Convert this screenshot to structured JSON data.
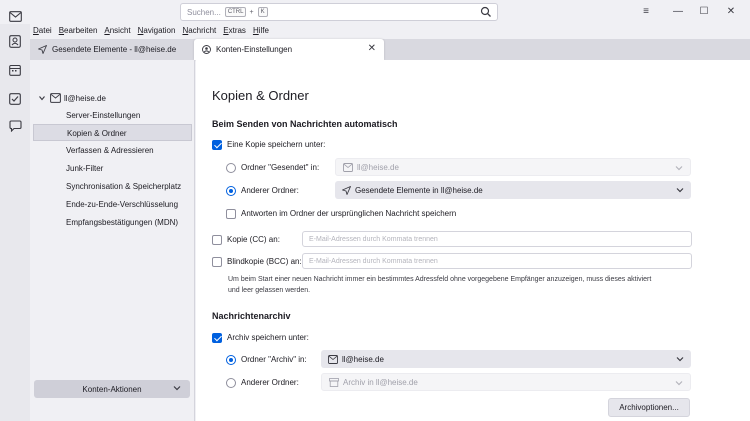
{
  "search": {
    "placeholder": "Suchen...",
    "shortcut_key1": "CTRL",
    "shortcut_plus": "+",
    "shortcut_key2": "K"
  },
  "window": {
    "menu": "≡",
    "minimize": "—",
    "maximize": "☐",
    "close": "✕"
  },
  "menubar": [
    "Datei",
    "Bearbeiten",
    "Ansicht",
    "Navigation",
    "Nachricht",
    "Extras",
    "Hilfe"
  ],
  "tabs": [
    {
      "label": "Gesendete Elemente - ll@heise.de",
      "icon": "send-icon"
    },
    {
      "label": "Konten-Einstellungen",
      "icon": "account-settings-icon",
      "close": "✕"
    }
  ],
  "tree": {
    "account": "ll@heise.de",
    "items": [
      "Server-Einstellungen",
      "Kopien & Ordner",
      "Verfassen & Adressieren",
      "Junk-Filter",
      "Synchronisation & Speicherplatz",
      "Ende-zu-Ende-Verschlüsselung",
      "Empfangsbestätigungen (MDN)"
    ],
    "selected_index": 1,
    "actions_label": "Konten-Aktionen"
  },
  "content": {
    "title": "Kopien & Ordner",
    "section_send": "Beim Senden von Nachrichten automatisch",
    "save_copy_label": "Eine Kopie speichern unter:",
    "radio_sent_folder": "Ordner \"Gesendet\" in:",
    "sent_folder_value": "ll@heise.de",
    "radio_other_folder": "Anderer Ordner:",
    "other_folder_value": "Gesendete Elemente in ll@heise.de",
    "reply_in_folder": "Antworten im Ordner der ursprünglichen Nachricht speichern",
    "cc_label": "Kopie (CC) an:",
    "cc_placeholder": "E-Mail-Adressen durch Kommata trennen",
    "bcc_label": "Blindkopie (BCC) an:",
    "bcc_placeholder": "E-Mail-Adressen durch Kommata trennen",
    "hint_line1": "Um beim Start einer neuen Nachricht immer ein bestimmtes Adressfeld ohne vorgegebene Empfänger anzuzeigen, muss dieses aktiviert",
    "hint_line2": "und leer gelassen werden.",
    "section_archive": "Nachrichtenarchiv",
    "archive_label": "Archiv speichern unter:",
    "radio_archive_folder": "Ordner \"Archiv\" in:",
    "archive_folder_value": "ll@heise.de",
    "radio_archive_other": "Anderer Ordner:",
    "archive_other_value": "Archiv in ll@heise.de",
    "archive_options_button": "Archivoptionen..."
  },
  "colors": {
    "accent": "#0060df",
    "background": "#f0f0f4",
    "content_bg": "#ffffff"
  }
}
